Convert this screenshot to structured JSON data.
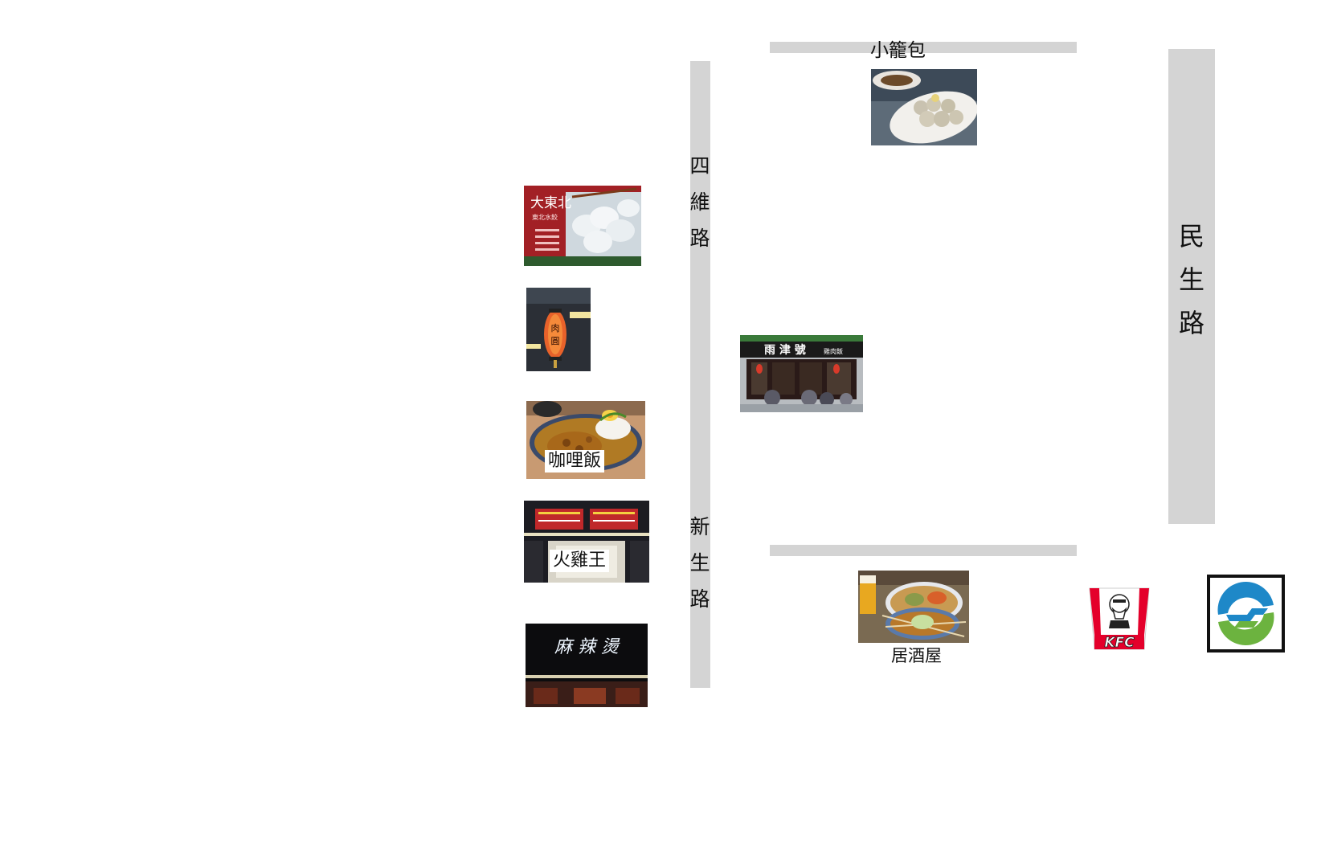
{
  "roads": {
    "siwei_chars": [
      "四",
      "維",
      "路"
    ],
    "xinsheng_chars": [
      "新",
      "生",
      "路"
    ],
    "minsheng_chars": [
      "民",
      "生",
      "路"
    ]
  },
  "shops": {
    "xiaolongbao_label": "小籠包",
    "curry_label": "咖哩飯",
    "turkey_label": "火雞王",
    "izakaya_label": "居酒屋",
    "dumpling_sign": "大東北",
    "dumpling_sub": "東北水餃",
    "meatball_sign": [
      "肉",
      "圓"
    ],
    "chicken_sign": "雨 津 號",
    "chicken_sub": "雞肉飯",
    "mala_sign": "麻 辣 燙",
    "kfc_text": "KFC"
  },
  "colors": {
    "road": "#d4d4d4",
    "kfc_red": "#e4002b",
    "metro_blue": "#1e88c8",
    "metro_green": "#6cb33f"
  }
}
